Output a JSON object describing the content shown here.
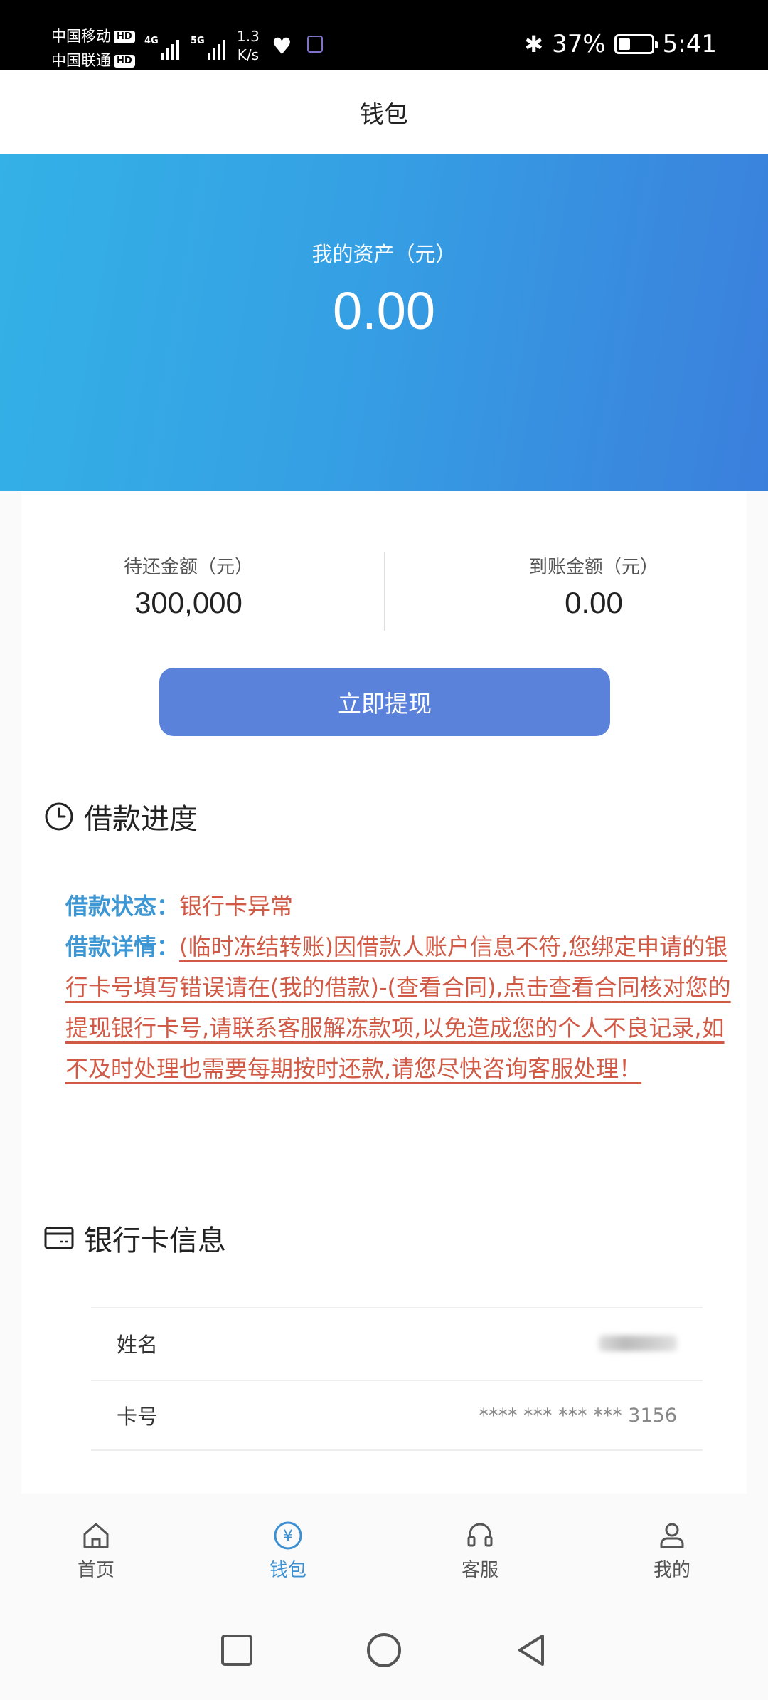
{
  "status_bar": {
    "carrier1": "中国移动",
    "carrier2": "中国联通",
    "hd": "HD",
    "net1": "4G",
    "net2": "5G",
    "speed_value": "1.3",
    "speed_unit": "K/s",
    "battery_text": "37%",
    "battery_level": 0.37,
    "time": "5:41"
  },
  "header": {
    "title": "钱包"
  },
  "banner": {
    "label": "我的资产（元）",
    "value": "0.00"
  },
  "summary": {
    "left_label": "待还金额（元）",
    "left_value": "300,000",
    "right_label": "到账金额（元）",
    "right_value": "0.00"
  },
  "withdraw_button": "立即提现",
  "progress": {
    "title": "借款进度",
    "status_key": "借款状态：",
    "status_value": "银行卡异常",
    "detail_key": "借款详情：",
    "detail_value": "(临时冻结转账)因借款人账户信息不符,您绑定申请的银行卡号填写错误请在(我的借款)-(查看合同),点击查看合同核对您的提现银行卡号,请联系客服解冻款项,以免造成您的个人不良记录,如不及时处理也需要每期按时还款,请您尽快咨询客服处理！"
  },
  "bank": {
    "title": "银行卡信息",
    "name_label": "姓名",
    "card_label": "卡号",
    "card_value": "**** *** *** *** 3156"
  },
  "tabs": [
    {
      "label": "首页",
      "icon": "home-icon"
    },
    {
      "label": "钱包",
      "icon": "wallet-icon"
    },
    {
      "label": "客服",
      "icon": "headset-icon"
    },
    {
      "label": "我的",
      "icon": "user-icon"
    }
  ],
  "colors": {
    "accent": "#3c8fd0",
    "button": "#5a82db",
    "alert": "#d05a45",
    "key_blue": "#3c97d4"
  }
}
